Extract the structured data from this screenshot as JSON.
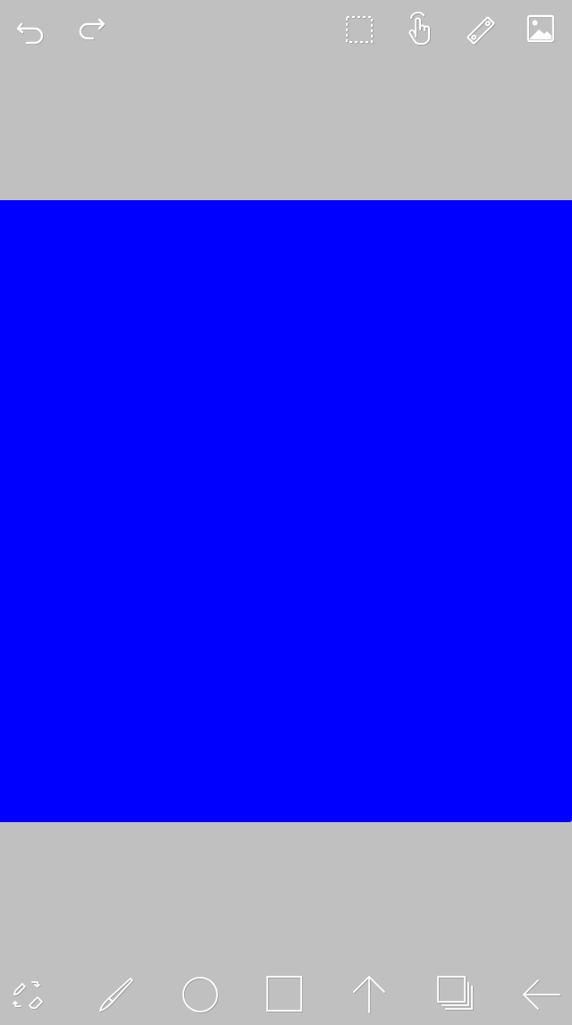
{
  "app": {
    "background_color": "#c0c0c0",
    "icon_color": "#ffffff",
    "icon_shadow_color": "#9a9a9a"
  },
  "canvas": {
    "fill_color": "#0000ff"
  },
  "top_toolbar": {
    "tools": [
      {
        "name": "undo-button",
        "icon": "undo-arrow-icon"
      },
      {
        "name": "redo-button",
        "icon": "redo-arrow-icon"
      },
      {
        "name": "select-button",
        "icon": "dashed-selection-icon"
      },
      {
        "name": "pan-button",
        "icon": "hand-pointer-icon"
      },
      {
        "name": "ruler-button",
        "icon": "ruler-icon"
      },
      {
        "name": "image-button",
        "icon": "image-icon"
      }
    ]
  },
  "bottom_toolbar": {
    "tools": [
      {
        "name": "swap-tool-button",
        "icon": "pen-eraser-swap-icon"
      },
      {
        "name": "brush-tool-button",
        "icon": "brush-icon"
      },
      {
        "name": "ellipse-tool-button",
        "icon": "circle-icon"
      },
      {
        "name": "rectangle-tool-button",
        "icon": "square-icon"
      },
      {
        "name": "arrow-tool-button",
        "icon": "arrow-up-icon"
      },
      {
        "name": "layers-button",
        "icon": "layers-icon"
      },
      {
        "name": "back-button",
        "icon": "arrow-left-icon"
      }
    ]
  }
}
